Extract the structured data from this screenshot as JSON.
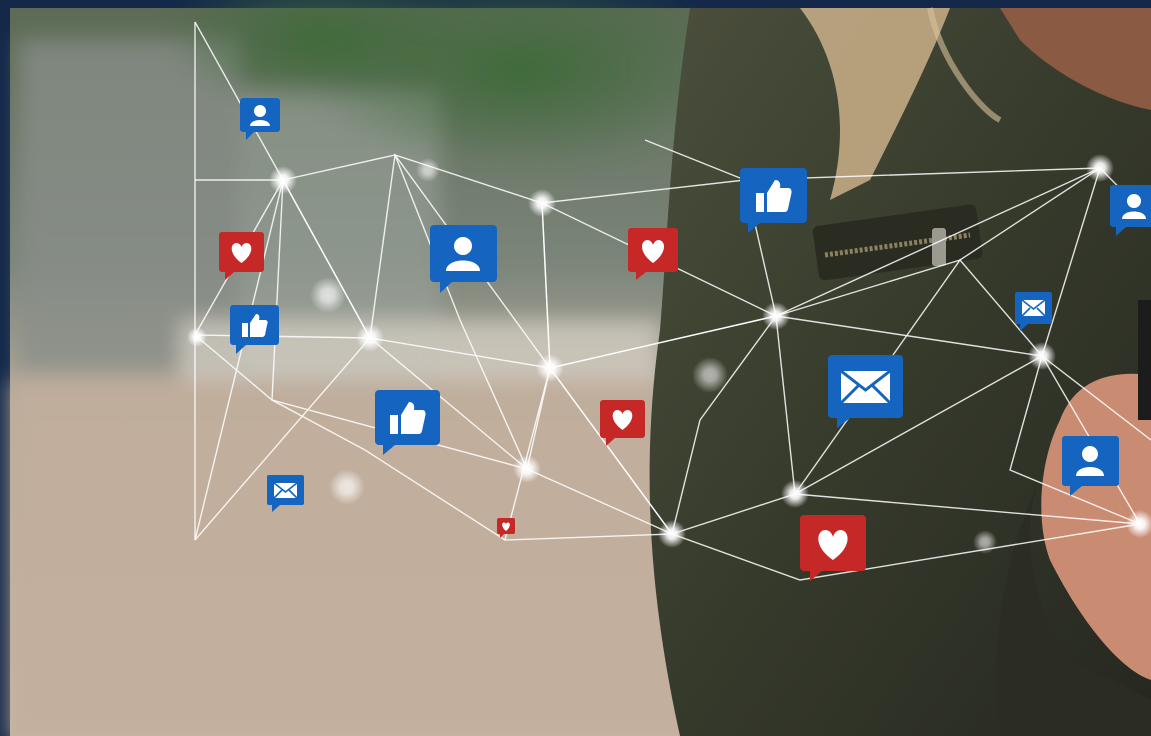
{
  "colors": {
    "frame_navy": "#14294a",
    "like_blue": "#1565c0",
    "heart_red": "#c62828",
    "network_line": "#ffffff",
    "jacket_olive": "#3a3f2e",
    "ground_beige": "#b9a392",
    "foliage_green": "#3f6a3a"
  },
  "icons": [
    "user-profile-icon",
    "heart-icon",
    "thumbs-up-icon",
    "envelope-icon"
  ]
}
